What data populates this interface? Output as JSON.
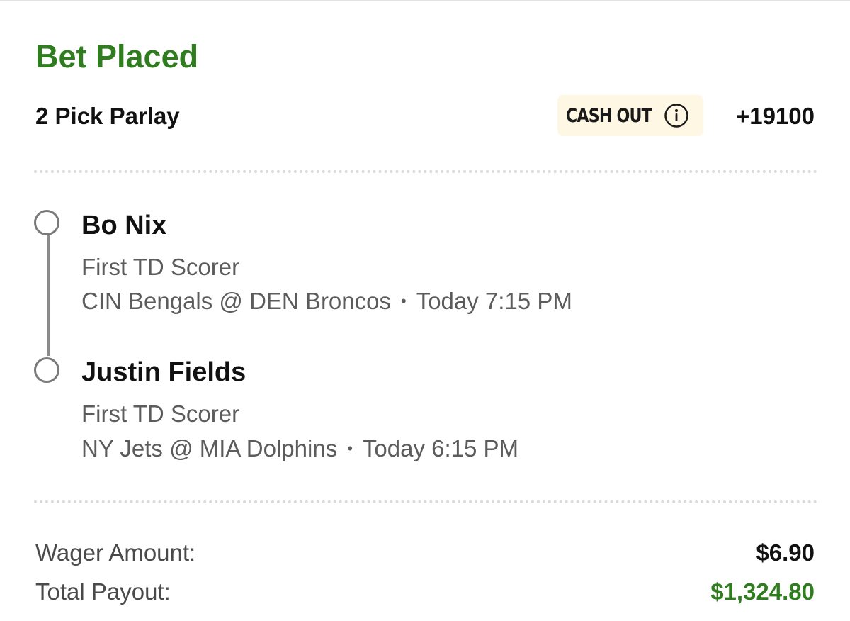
{
  "header": {
    "status": "Bet Placed",
    "bet_type": "2 Pick Parlay",
    "cash_out_label": "CASH OUT",
    "odds": "+19100"
  },
  "legs": [
    {
      "player": "Bo Nix",
      "market": "First TD Scorer",
      "matchup": "CIN Bengals @ DEN Broncos",
      "separator": "•",
      "time": "Today 7:15 PM"
    },
    {
      "player": "Justin Fields",
      "market": "First TD Scorer",
      "matchup": "NY Jets @ MIA Dolphins",
      "separator": "•",
      "time": "Today 6:15 PM"
    }
  ],
  "summary": {
    "wager_label": "Wager Amount:",
    "wager_value": "$6.90",
    "payout_label": "Total Payout:",
    "payout_value": "$1,324.80"
  },
  "icons": {
    "info": "info-circle-icon",
    "leg_status": "open-circle-icon"
  },
  "colors": {
    "accent_green": "#2f7d1f",
    "cash_out_bg": "#fdf7e3",
    "divider": "#d9d9d9",
    "secondary_text": "#5c5c5c"
  }
}
